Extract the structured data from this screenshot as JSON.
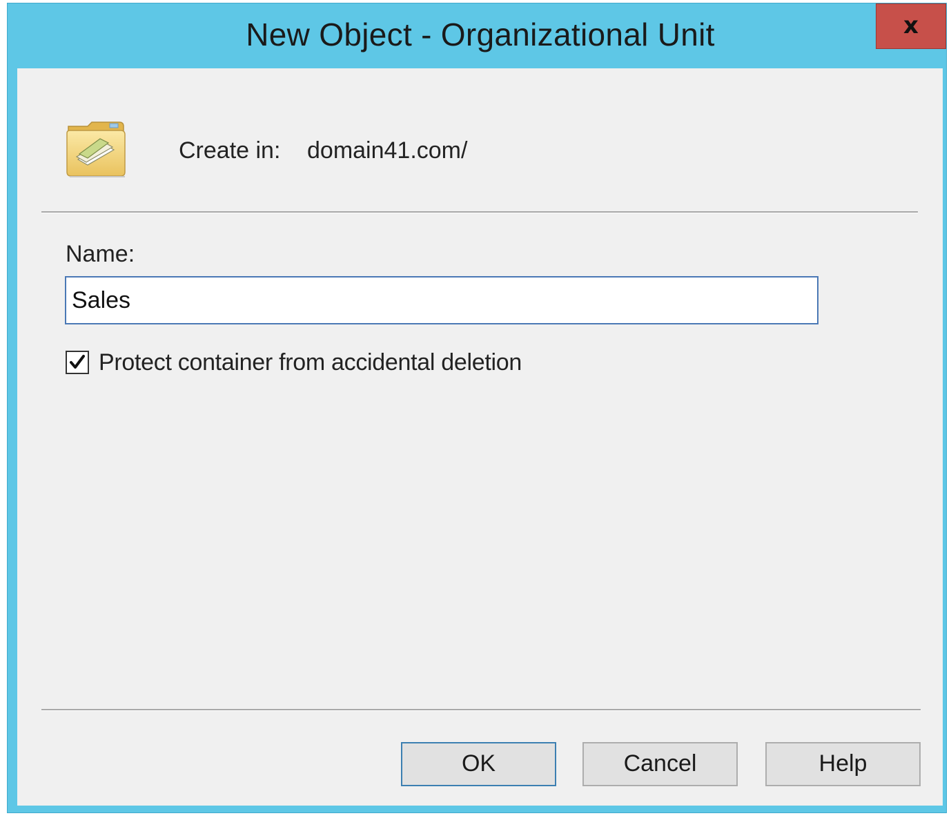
{
  "window": {
    "title": "New Object - Organizational Unit",
    "close_label": "x"
  },
  "header": {
    "icon": "organizational-unit-folder-icon",
    "create_in_label": "Create in:",
    "create_in_value": "domain41.com/"
  },
  "form": {
    "name_label": "Name:",
    "name_value": "Sales",
    "protect_label": "Protect container from accidental deletion",
    "protect_checked": true
  },
  "buttons": {
    "ok": "OK",
    "cancel": "Cancel",
    "help": "Help"
  },
  "colors": {
    "titlebar": "#5ec7e6",
    "close_button": "#c7504a",
    "client_bg": "#f0f0f0",
    "input_border": "#4a78b5"
  }
}
